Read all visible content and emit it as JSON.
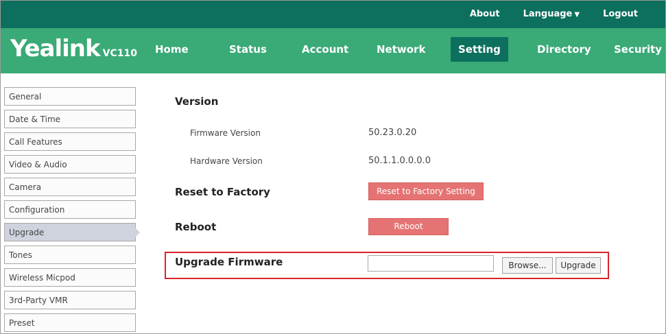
{
  "top_links": {
    "about": "About",
    "language": "Language",
    "logout": "Logout"
  },
  "logo": {
    "brand": "Yealink",
    "model": "VC110"
  },
  "nav": {
    "home": "Home",
    "status": "Status",
    "account": "Account",
    "network": "Network",
    "setting": "Setting",
    "directory": "Directory",
    "security": "Security"
  },
  "active_nav": "Setting",
  "sidebar": {
    "items": [
      "General",
      "Date & Time",
      "Call Features",
      "Video & Audio",
      "Camera",
      "Configuration",
      "Upgrade",
      "Tones",
      "Wireless Micpod",
      "3rd-Party VMR",
      "Preset"
    ],
    "active": "Upgrade"
  },
  "version": {
    "title": "Version",
    "firmware_label": "Firmware Version",
    "firmware_value": "50.23.0.20",
    "hardware_label": "Hardware Version",
    "hardware_value": "50.1.1.0.0.0.0"
  },
  "reset": {
    "label": "Reset to Factory",
    "button": "Reset to Factory Setting"
  },
  "reboot": {
    "label": "Reboot",
    "button": "Reboot"
  },
  "upgrade_firmware": {
    "label": "Upgrade Firmware",
    "file_value": "",
    "browse_button": "Browse...",
    "upgrade_button": "Upgrade"
  },
  "colors": {
    "top_bar": "#0d6f5d",
    "nav_bar": "#3aaa77",
    "active_tab": "#0d6f5d",
    "red_button": "#e57373",
    "highlight_border": "#d8232a"
  }
}
